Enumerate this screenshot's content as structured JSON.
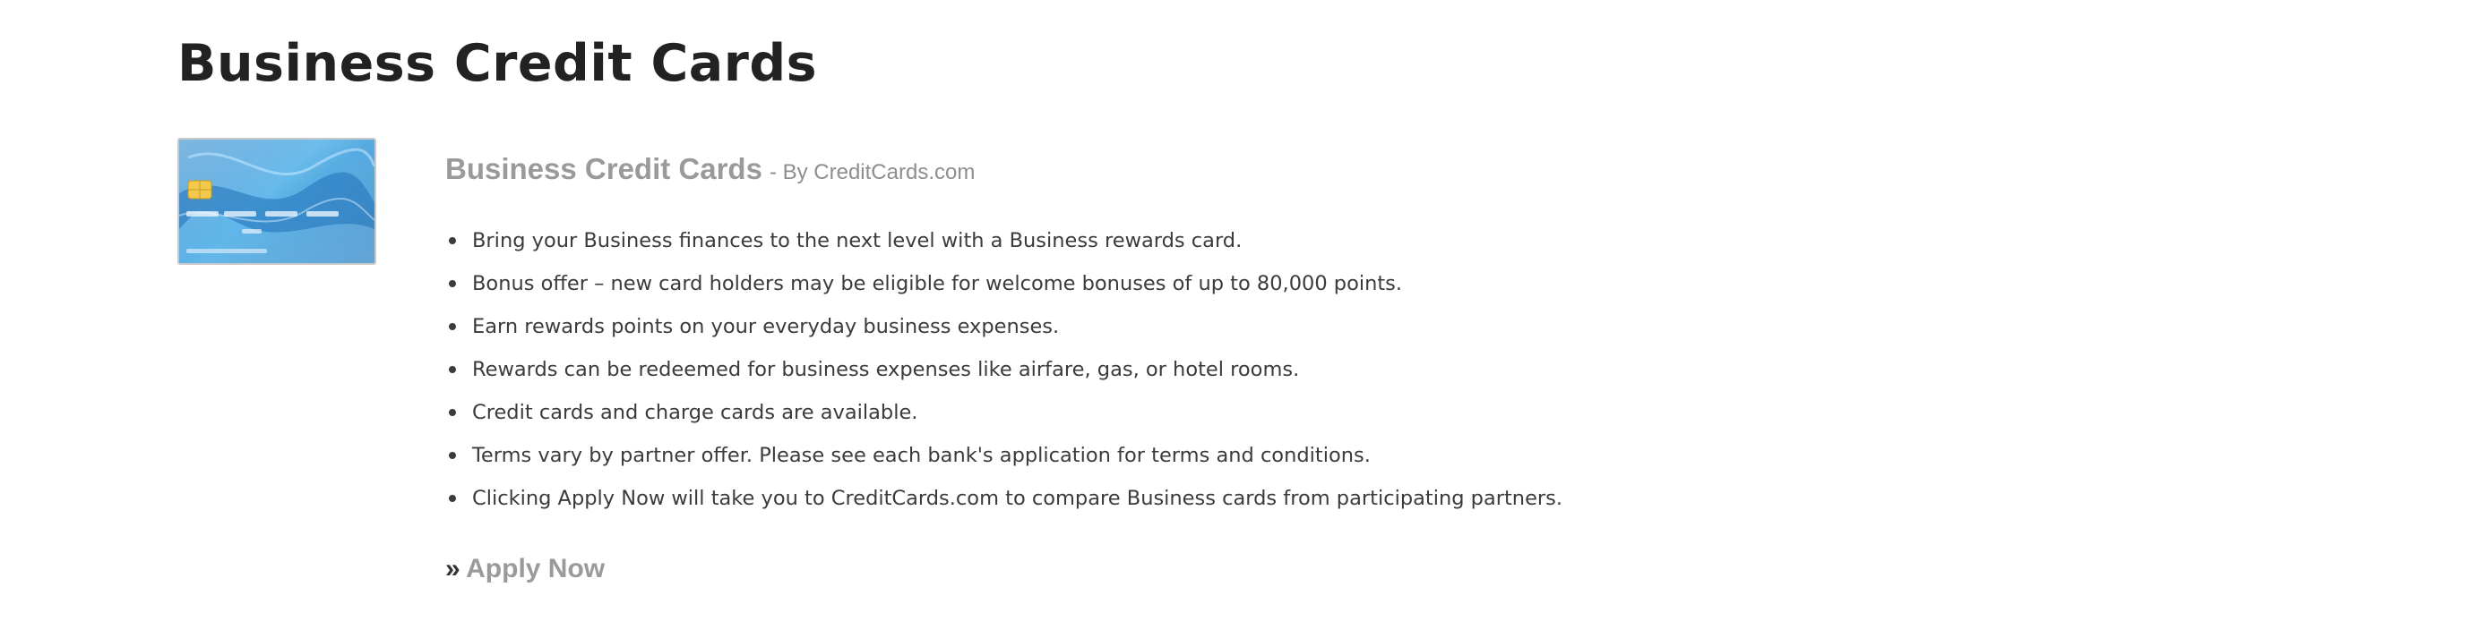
{
  "page": {
    "title": "Business Credit Cards"
  },
  "offer": {
    "card_image_icon": "credit-card-icon",
    "name": "Business Credit Cards",
    "byline": "- By CreditCards.com",
    "bullets": [
      "Bring your Business finances to the next level with a Business rewards card.",
      "Bonus offer – new card holders may be eligible for welcome bonuses of up to 80,000 points.",
      "Earn rewards points on your everyday business expenses.",
      "Rewards can be redeemed for business expenses like airfare, gas, or hotel rooms.",
      "Credit cards and charge cards are available.",
      "Terms vary by partner offer. Please see each bank's application for terms and conditions.",
      "Clicking Apply Now will take you to CreditCards.com to compare Business cards from participating partners."
    ],
    "apply": {
      "arrow": "»",
      "label": "Apply Now"
    }
  },
  "colors": {
    "title": "#222222",
    "muted_heading": "#9a9a9a",
    "body_text": "#3b3b3b",
    "card_blue": "#3a8fd0"
  }
}
